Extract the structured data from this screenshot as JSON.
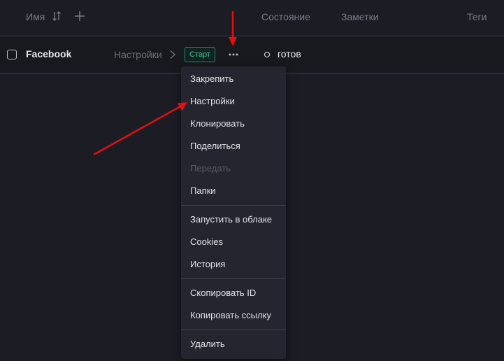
{
  "columns": {
    "name": "Имя",
    "state": "Состояние",
    "notes": "Заметки",
    "tags": "Теги"
  },
  "row": {
    "profile_name": "Facebook",
    "settings_link": "Настройки",
    "start_button": "Старт",
    "status": "готов"
  },
  "menu": {
    "pin": "Закрепить",
    "settings": "Настройки",
    "clone": "Клонировать",
    "share": "Поделиться",
    "transfer": "Передать",
    "folders": "Папки",
    "run_cloud": "Запустить в облаке",
    "cookies": "Cookies",
    "history": "История",
    "copy_id": "Скопировать ID",
    "copy_link": "Копировать ссылку",
    "delete": "Удалить"
  },
  "colors": {
    "background": "#1c1c25",
    "accent": "#2fc59e",
    "annotation_arrow": "#e01010"
  },
  "icons": {
    "sort": "sort-icon",
    "add_column": "plus-icon",
    "chevron": "chevron-right-icon",
    "more": "more-horizontal-icon"
  }
}
